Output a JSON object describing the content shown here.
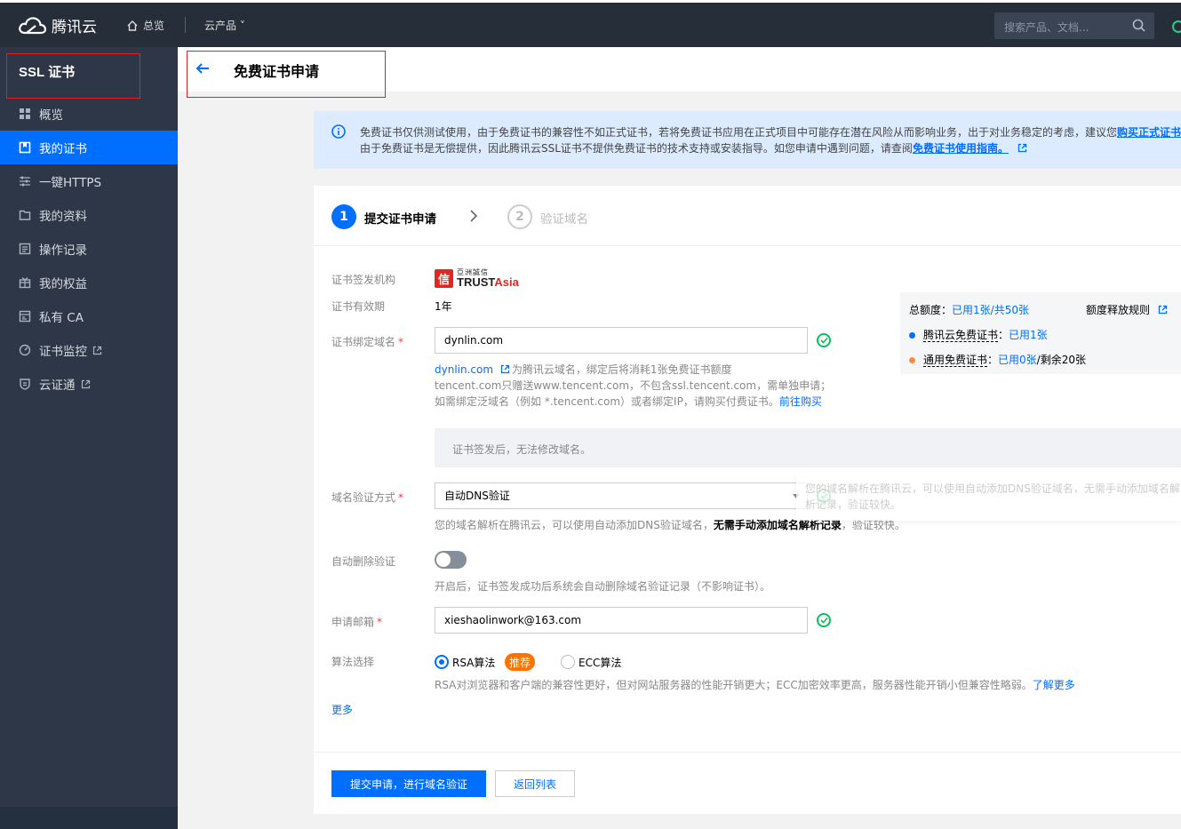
{
  "topbar": {
    "brand": "腾讯云",
    "home_label": "总览",
    "products_label": "云产品 ˅",
    "search_placeholder": "搜索产品、文档..."
  },
  "sidebar": {
    "title": "SSL 证书",
    "items": [
      {
        "label": "概览",
        "icon": "grid-icon"
      },
      {
        "label": "我的证书",
        "icon": "certificate-icon"
      },
      {
        "label": "一键HTTPS",
        "icon": "sliders-icon"
      },
      {
        "label": "我的资料",
        "icon": "folder-icon"
      },
      {
        "label": "操作记录",
        "icon": "list-icon"
      },
      {
        "label": "我的权益",
        "icon": "gift-icon"
      },
      {
        "label": "私有 CA",
        "icon": "ca-icon"
      },
      {
        "label": "证书监控",
        "icon": "monitor-icon"
      },
      {
        "label": "云证通",
        "icon": "shield-icon"
      }
    ]
  },
  "header": {
    "title": "免费证书申请"
  },
  "notice": {
    "line1_text": "免费证书仅供测试使用，由于免费证书的兼容性不如正式证书，若将免费证书应用在正式项目中可能存在潜在风险从而影响业务，出于对业务稳定的考虑，建议您",
    "line1_link": "购买正式证书",
    "line2_text": "由于免费证书是无偿提供，因此腾讯云SSL证书不提供免费证书的技术支持或安装指导。如您申请中遇到问题，请查阅",
    "line2_link": "免费证书使用指南。"
  },
  "steps": [
    {
      "num": "1",
      "label": "提交证书申请"
    },
    {
      "num": "2",
      "label": "验证域名"
    }
  ],
  "form": {
    "issuer_label": "证书签发机构",
    "issuer_logo_cn": "亞洲誠信",
    "issuer_logo_en_a": "TRUST",
    "issuer_logo_en_b": "Asia",
    "validity_label": "证书有效期",
    "validity_value": "1年",
    "domain_label": "证书绑定域名",
    "domain_value": "dynlin.com",
    "domain_hint_link": "dynlin.com",
    "domain_hint_1": "为腾讯云域名，绑定后将消耗1张免费证书额度",
    "domain_hint_2": "tencent.com只赠送www.tencent.com，不包含ssl.tencent.com，需单独申请；",
    "domain_hint_3": "如需绑定泛域名（例如 *.tencent.com）或者绑定IP，请购买付费证书。",
    "domain_hint_buy": "前往购买",
    "lock_banner": "证书签发后，无法修改域名。",
    "verify_label": "域名验证方式",
    "verify_value": "自动DNS验证",
    "verify_hint_a": "您的域名解析在腾讯云，可以使用自动添加DNS验证域名，",
    "verify_hint_b": "无需手动添加域名解析记录",
    "verify_hint_c": "，验证较快。",
    "autodel_label": "自动删除验证",
    "autodel_enabled": false,
    "autodel_hint": "开启后，证书签发成功后系统会自动删除域名验证记录（不影响证书）。",
    "email_label": "申请邮箱",
    "email_value": "xieshaolinwork@163.com",
    "algo_label": "算法选择",
    "algo_rsa": "RSA算法",
    "algo_badge": "推荐",
    "algo_ecc": "ECC算法",
    "algo_selected": "RSA算法",
    "algo_hint": "RSA对浏览器和客户端的兼容性更好，但对网站服务器的性能开销更大；ECC加密效率更高，服务器性能开销小但兼容性略弱。",
    "algo_more": "了解更多",
    "more_link": "更多"
  },
  "quota": {
    "total_label": "总额度：",
    "total_value": "已用1张/共50张",
    "rule_link": "额度释放规则",
    "row1_name": "腾讯云免费证书",
    "row1_value": "已用1张",
    "row2_name": "通用免费证书",
    "row2_used": "已用0张",
    "row2_rest": "/剩余20张"
  },
  "tooltip": {
    "line1": "您的域名解析在腾讯云，可以使用自动添加DNS验证域名，无需手动添加域名解",
    "line2": "析记录，验证较快。"
  },
  "buttons": {
    "submit": "提交申请，进行域名验证",
    "back": "返回列表"
  },
  "colors": {
    "accent": "#006eff",
    "sidebar_bg": "#2d3747",
    "topbar_bg": "#262e3a",
    "success": "#0abf5b",
    "badge": "#ff7200"
  }
}
